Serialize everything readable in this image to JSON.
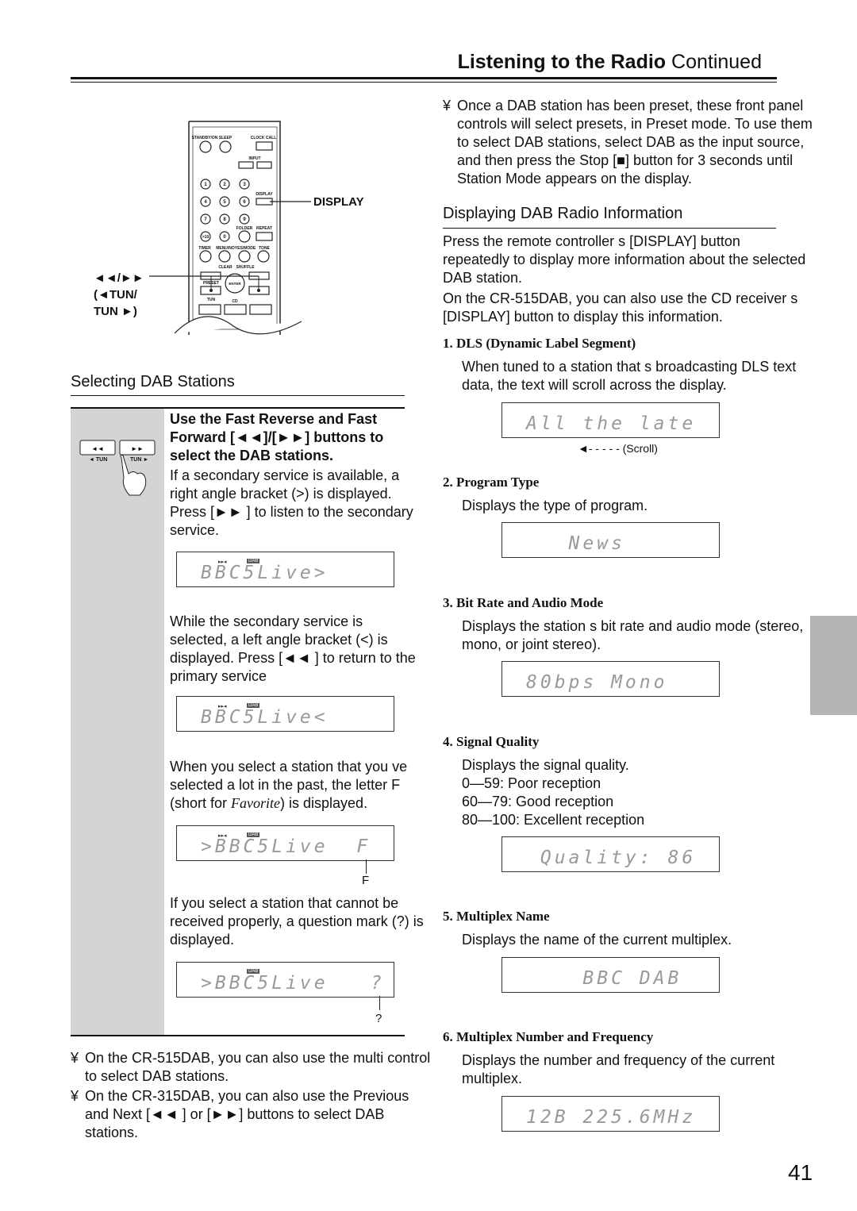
{
  "header": {
    "title_bold": "Listening to the Radio",
    "title_rest": " Continued"
  },
  "remote": {
    "display_label": "DISPLAY",
    "tun_label_1": "◄◄/►►",
    "tun_label_2": "(◄TUN/",
    "tun_label_3": "TUN ►)",
    "buttons": [
      "STANDBY/ON",
      "SLEEP",
      "CLOCK CALL",
      "INPUT",
      "1",
      "2",
      "3",
      "4",
      "5",
      "6",
      "7",
      "8",
      "9",
      ">10",
      "0",
      "DISPLAY",
      "FOLDER",
      "REPEAT",
      "TIMER",
      "MENU/NO",
      "YES/MODE",
      "TONE",
      "CLEAR",
      "SHUFFLE",
      "ENTER",
      "PRESET",
      "TUN",
      "CD"
    ]
  },
  "left": {
    "section_title": "Selecting DAB Stations",
    "step_bold": "Use the Fast Reverse and Fast Forward [◄◄]/[►►] buttons to select the DAB stations.",
    "step_tun_left": "◄ TUN",
    "step_tun_right": "TUN ►",
    "p1": "If a secondary service is available, a right angle bracket (>) is displayed. Press [►► ] to listen to the secondary service.",
    "lcd1": "BBC5Live>",
    "p2": "While the secondary service is selected, a left angle bracket (<) is displayed. Press [◄◄ ] to return to the primary service",
    "lcd2": "BBC5Live<",
    "p3_a": "When you select a station that you ve selected a lot in the past, the letter F (short for ",
    "p3_em": "Favorite",
    "p3_b": ") is displayed.",
    "lcd3": ">BBC5Live  F",
    "lcd3_callout": "F",
    "p4": "If you select a station that cannot be received properly, a question mark (?) is displayed.",
    "lcd4": ">BBC5Live   ?",
    "lcd4_callout": "?",
    "lcd_dab": "DAB",
    "lcd_ind": "▸▸◂",
    "bullets": [
      "On the CR-515DAB, you can also use the multi control to select DAB stations.",
      "On the CR-315DAB, you can also use the Previous and Next [◄◄ ] or [►►] buttons to select DAB stations."
    ],
    "bullet_mark": "¥"
  },
  "right": {
    "bullet_mark": "¥",
    "bullet": "Once a DAB station has been preset, these front panel controls will select presets, in Preset mode. To use them to select DAB stations, select DAB as the input source, and then press the Stop [■] button for 3 seconds until  Station Mode  appears on the display.",
    "section_title": "Displaying DAB Radio Information",
    "intro1": "Press the remote controller s [DISPLAY] button repeatedly to display more information about the selected DAB station.",
    "intro2": "On the CR-515DAB, you can also use the CD receiver s [DISPLAY] button to display this information.",
    "items": [
      {
        "num": "1.",
        "title": "DLS (Dynamic Label Segment)",
        "desc": "When tuned to a station that s broadcasting DLS text data, the text will scroll across the display.",
        "lcd": "All the late"
      },
      {
        "num": "2.",
        "title": "Program Type",
        "desc": "Displays the type of program.",
        "lcd": "   News"
      },
      {
        "num": "3.",
        "title": "Bit Rate and Audio Mode",
        "desc": "Displays the station s bit rate and audio mode (stereo, mono, or joint stereo).",
        "lcd": "80bps Mono"
      },
      {
        "num": "4.",
        "title": "Signal Quality",
        "desc": "Displays the signal quality.",
        "lines": [
          "0—59: Poor reception",
          "60—79: Good reception",
          "80—100: Excellent reception"
        ],
        "lcd": " Quality: 86"
      },
      {
        "num": "5.",
        "title": "Multiplex Name",
        "desc": "Displays the name of the current multiplex.",
        "lcd": "    BBC DAB"
      },
      {
        "num": "6.",
        "title": "Multiplex Number and Frequency",
        "desc": "Displays the number and frequency of the current multiplex.",
        "lcd": "12B 225.6MHz"
      }
    ],
    "scroll_label": "(Scroll)"
  },
  "page_number": "41",
  "colors": {
    "gray_panel": "#d4d4d4",
    "side_tab": "#b4b4b4",
    "lcd_text": "#999999"
  }
}
